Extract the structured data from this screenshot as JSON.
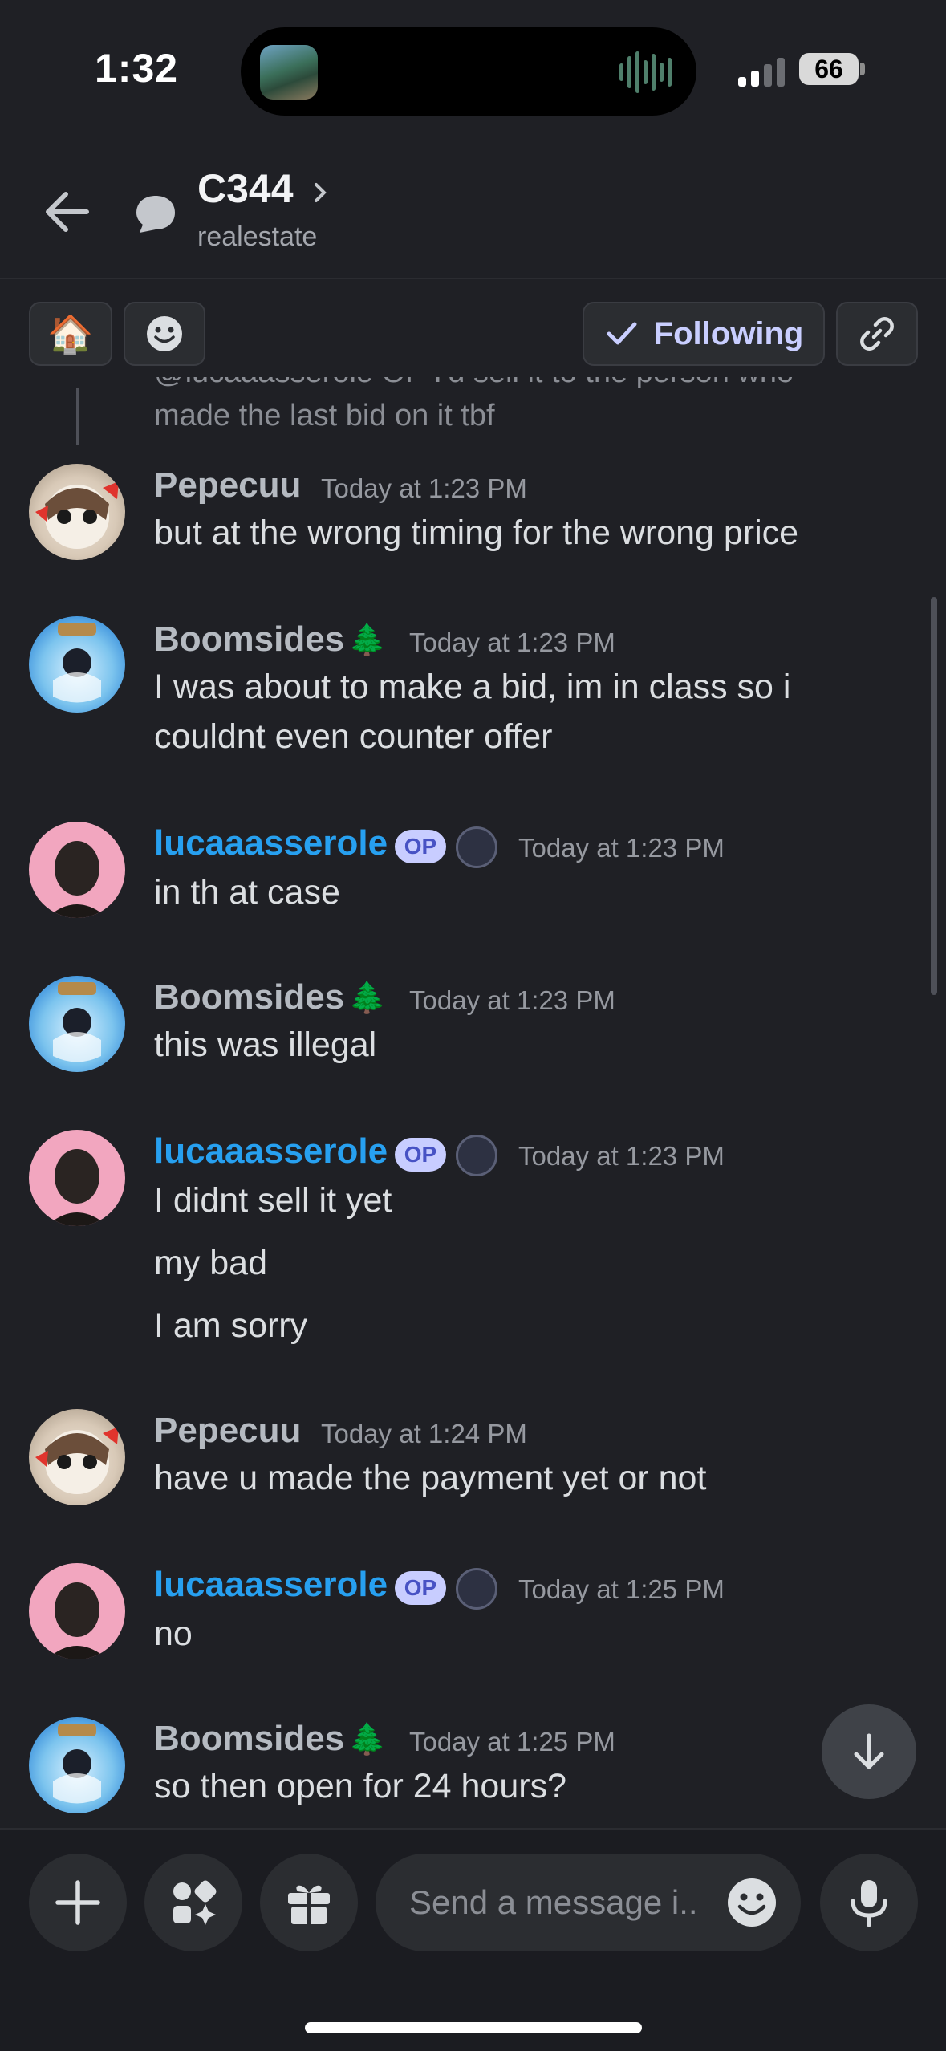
{
  "status_bar": {
    "time": "1:32",
    "battery": "66"
  },
  "header": {
    "title": "C344",
    "subtitle": "realestate"
  },
  "actions": {
    "house_emoji": "🏠",
    "follow_label": "Following"
  },
  "reply_preview": {
    "top_text": "@lucaaasserole OP I'd sell it to the person who",
    "bottom_text": "made the last bid on it tbf"
  },
  "messages": [
    {
      "author": "Pepecuu",
      "timestamp": "Today at 1:23 PM",
      "lines": [
        "but at the wrong timing for the wrong price"
      ]
    },
    {
      "author": "Boomsides",
      "decoration": "🌲",
      "timestamp": "Today at 1:23 PM",
      "lines": [
        "I was about to make a bid, im in class so i",
        "couldnt even counter offer"
      ]
    },
    {
      "author": "lucaaasserole",
      "badge": "OP",
      "timestamp": "Today at 1:23 PM",
      "lines": [
        "in th at case"
      ]
    },
    {
      "author": "Boomsides",
      "decoration": "🌲",
      "timestamp": "Today at 1:23 PM",
      "lines": [
        "this was illegal"
      ]
    },
    {
      "author": "lucaaasserole",
      "badge": "OP",
      "timestamp": "Today at 1:23 PM",
      "lines": [
        "I didnt sell it yet",
        "my bad",
        "I am sorry"
      ]
    },
    {
      "author": "Pepecuu",
      "timestamp": "Today at 1:24 PM",
      "lines": [
        "have u made the payment yet or not"
      ]
    },
    {
      "author": "lucaaasserole",
      "badge": "OP",
      "timestamp": "Today at 1:25 PM",
      "lines": [
        "no"
      ]
    },
    {
      "author": "Boomsides",
      "decoration": "🌲",
      "timestamp": "Today at 1:25 PM",
      "lines": [
        "so then open for 24 hours?"
      ]
    }
  ],
  "composer": {
    "placeholder": "Send a message i.."
  },
  "icons": {
    "back": "arrow-left-icon",
    "thread": "thread-bubble-icon",
    "chevron": "chevron-right-icon",
    "follow_check": "check-icon",
    "link": "link-icon",
    "emoji": "smiley-icon",
    "plus": "plus-icon",
    "apps": "apps-sparkle-icon",
    "gift": "gift-icon",
    "mic": "microphone-icon",
    "jump": "arrow-down-icon"
  },
  "colors": {
    "background": "#1f2025",
    "op_name": "#27a0f0",
    "op_badge": "#c8cdff",
    "following": "#c9ceff"
  }
}
